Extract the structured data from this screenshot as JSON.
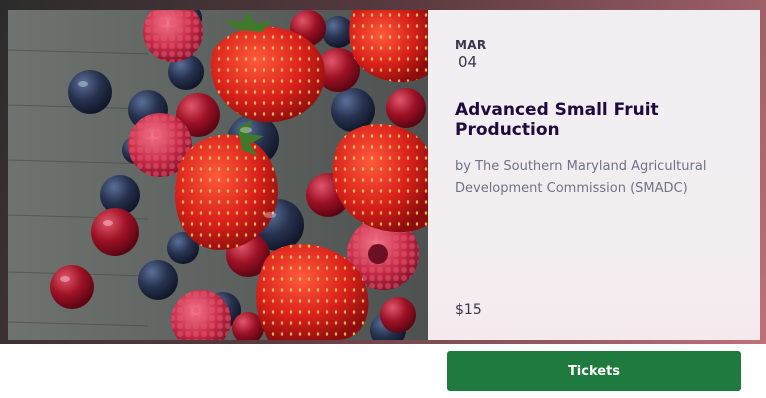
{
  "event": {
    "month": "MAR",
    "day": "04",
    "title": "Advanced Small Fruit Production",
    "organizer": "by The Southern Maryland Agricultural Development Commission (SMADC)",
    "price": "$15"
  },
  "actions": {
    "tickets_label": "Tickets"
  },
  "image": {
    "subject": "berries-photo"
  },
  "colors": {
    "button": "#1f7a40",
    "title": "#1e0a3c",
    "panel": "#f1eef2"
  }
}
